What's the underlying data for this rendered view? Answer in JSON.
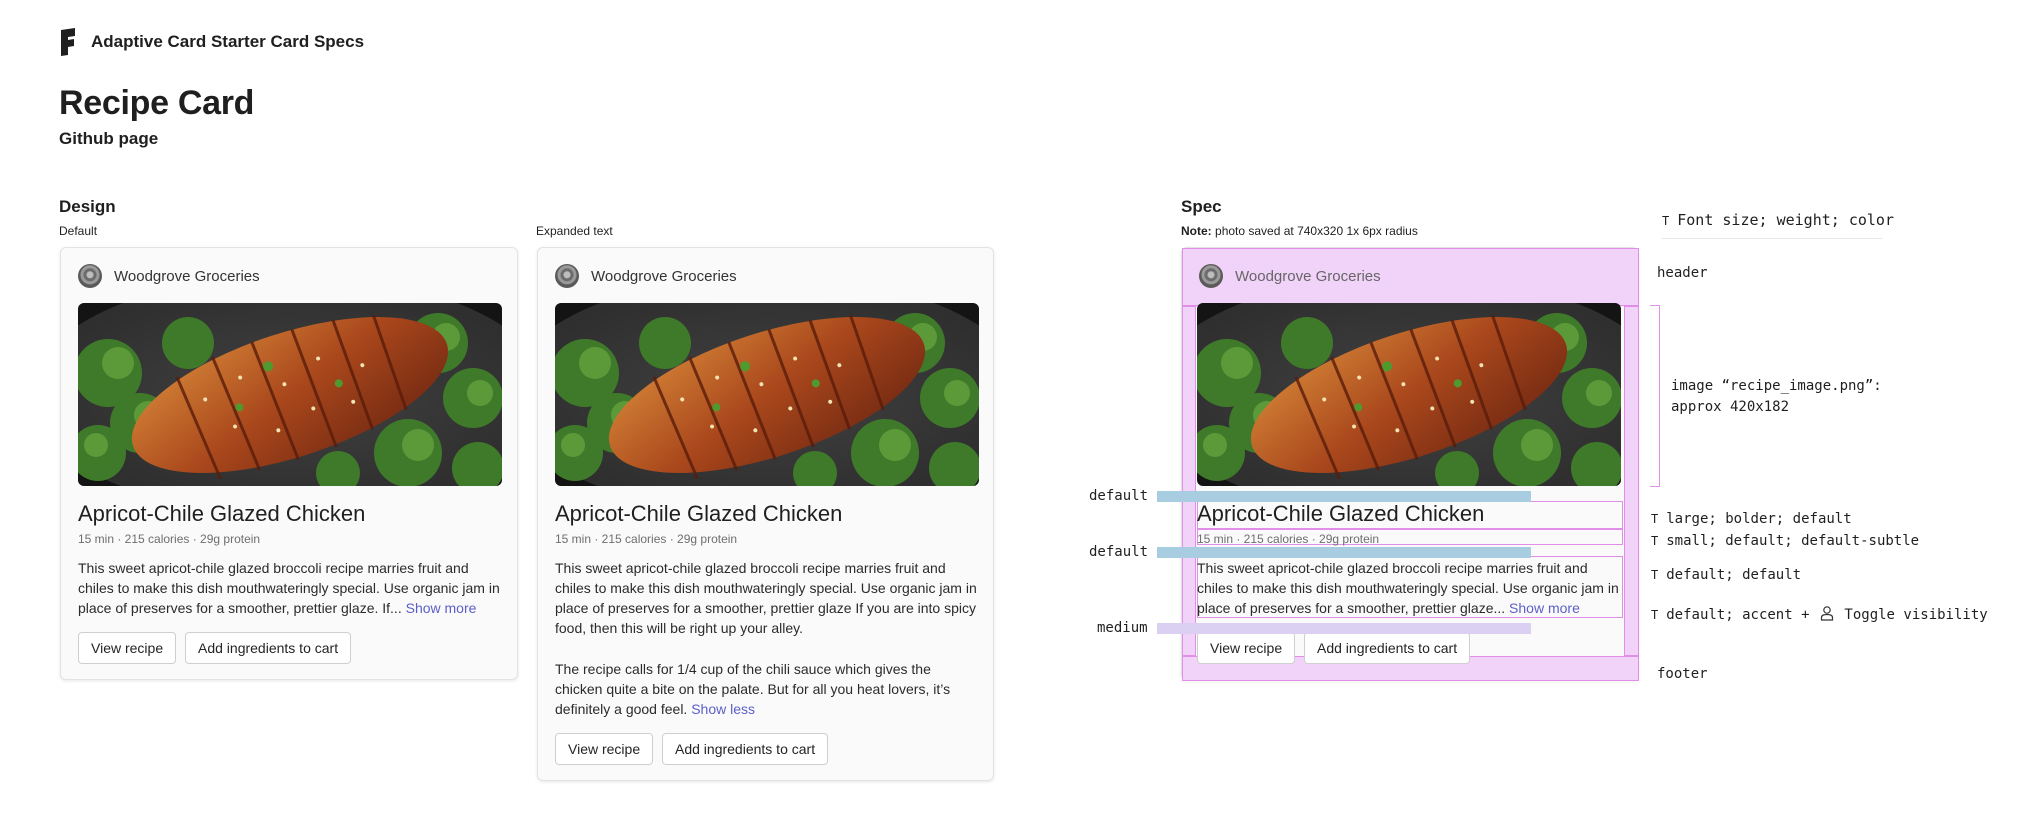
{
  "header": {
    "brand_title": "Adaptive Card Starter Card Specs",
    "page_title": "Recipe Card",
    "page_subtitle": "Github page"
  },
  "design": {
    "title": "Design",
    "default_label": "Default",
    "expanded_label": "Expanded text"
  },
  "spec": {
    "title": "Spec",
    "note_bold": "Note:",
    "note": "photo saved at 740x320 1x 6px radius",
    "legend": "Font size; weight; color",
    "header_label": "header",
    "image_note_line1": "image “recipe_image.png”:",
    "image_note_line2": "approx 420x182",
    "title_spec": "large; bolder; default",
    "meta_spec": "small; default; default-subtle",
    "desc_spec": "default; default",
    "link_spec": "default; accent +",
    "toggle_spec": "Toggle visibility",
    "spacing_default_1": "default",
    "spacing_default_2": "default",
    "spacing_medium": "medium",
    "footer_label": "footer",
    "colors": {
      "highlight": "#f1d2f9",
      "highlight_border": "#e08ee8",
      "bar_blue": "#a9cde0",
      "bar_purple": "#dcd0f2"
    }
  },
  "card": {
    "brand": "Woodgrove Groceries",
    "title": "Apricot-Chile Glazed Chicken",
    "meta": "15 min · 215 calories · 29g protein",
    "desc_short": "This sweet apricot-chile glazed broccoli recipe marries fruit and chiles to make this dish mouthwateringly special. Use organic jam in place of preserves for a smoother, prettier glaze. If...",
    "desc_short_spec": "This sweet apricot-chile glazed broccoli recipe marries fruit and chiles to make this dish mouthwateringly special. Use organic jam in place of preserves for a smoother, prettier glaze...",
    "show_more": "Show more",
    "desc_expanded_1": "This sweet apricot-chile glazed broccoli recipe marries fruit and chiles to make this dish mouthwateringly special. Use organic jam in place of preserves for a smoother, prettier glaze If you are into spicy food, then this will be right up your alley.",
    "desc_expanded_2": "The recipe calls for 1/4 cup of the chili sauce which gives the chicken quite a bite on the palate. But for all you heat lovers, it’s definitely a good feel.",
    "show_less": "Show less",
    "btn_view": "View recipe",
    "btn_cart": "Add ingredients to cart",
    "link_color": "#5b5fc7"
  }
}
